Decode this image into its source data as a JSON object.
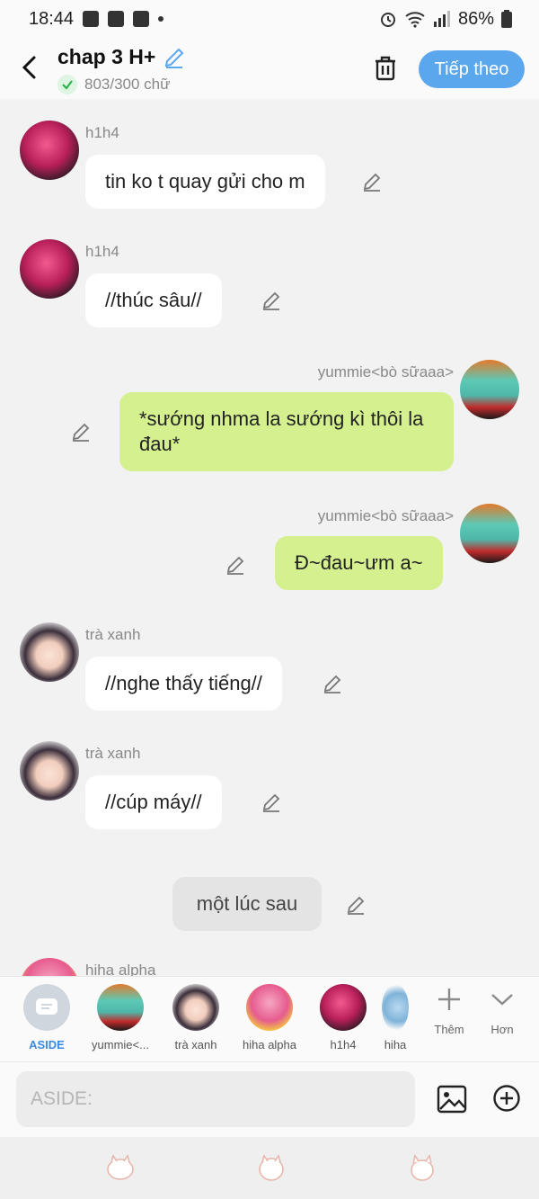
{
  "status_bar": {
    "time": "18:44",
    "battery": "86%"
  },
  "header": {
    "title": "chap 3 H+",
    "word_count": "803/300 chữ",
    "next_label": "Tiếp theo"
  },
  "messages": [
    {
      "sender": "h1h4",
      "text": "tin ko t quay gửi cho m",
      "side": "left"
    },
    {
      "sender": "h1h4",
      "text": "//thúc sâu//",
      "side": "left"
    },
    {
      "sender": "yummie<bò sữaaa>",
      "text": "*sướng nhma la sướng kì thôi la đau*",
      "side": "right"
    },
    {
      "sender": "yummie<bò sữaaa>",
      "text": "Đ~đau~ưm a~",
      "side": "right"
    },
    {
      "sender": "trà xanh",
      "text": "//nghe thấy tiếng//",
      "side": "left"
    },
    {
      "sender": "trà xanh",
      "text": "//cúp máy//",
      "side": "left"
    },
    {
      "sender": "",
      "text": "một lúc sau",
      "side": "narration"
    },
    {
      "sender": "hiha alpha",
      "text": "",
      "side": "left"
    }
  ],
  "characters": [
    {
      "label": "ASIDE"
    },
    {
      "label": "yummie<..."
    },
    {
      "label": "trà xanh"
    },
    {
      "label": "hiha alpha"
    },
    {
      "label": "h1h4"
    },
    {
      "label": "hiha"
    }
  ],
  "tools": {
    "add_label": "Thêm",
    "more_label": "Hơn"
  },
  "input": {
    "placeholder": "ASIDE:"
  },
  "colors": {
    "accent": "#5ba7ee",
    "my_bubble": "#d5f08e",
    "aside": "#3a8be0"
  }
}
